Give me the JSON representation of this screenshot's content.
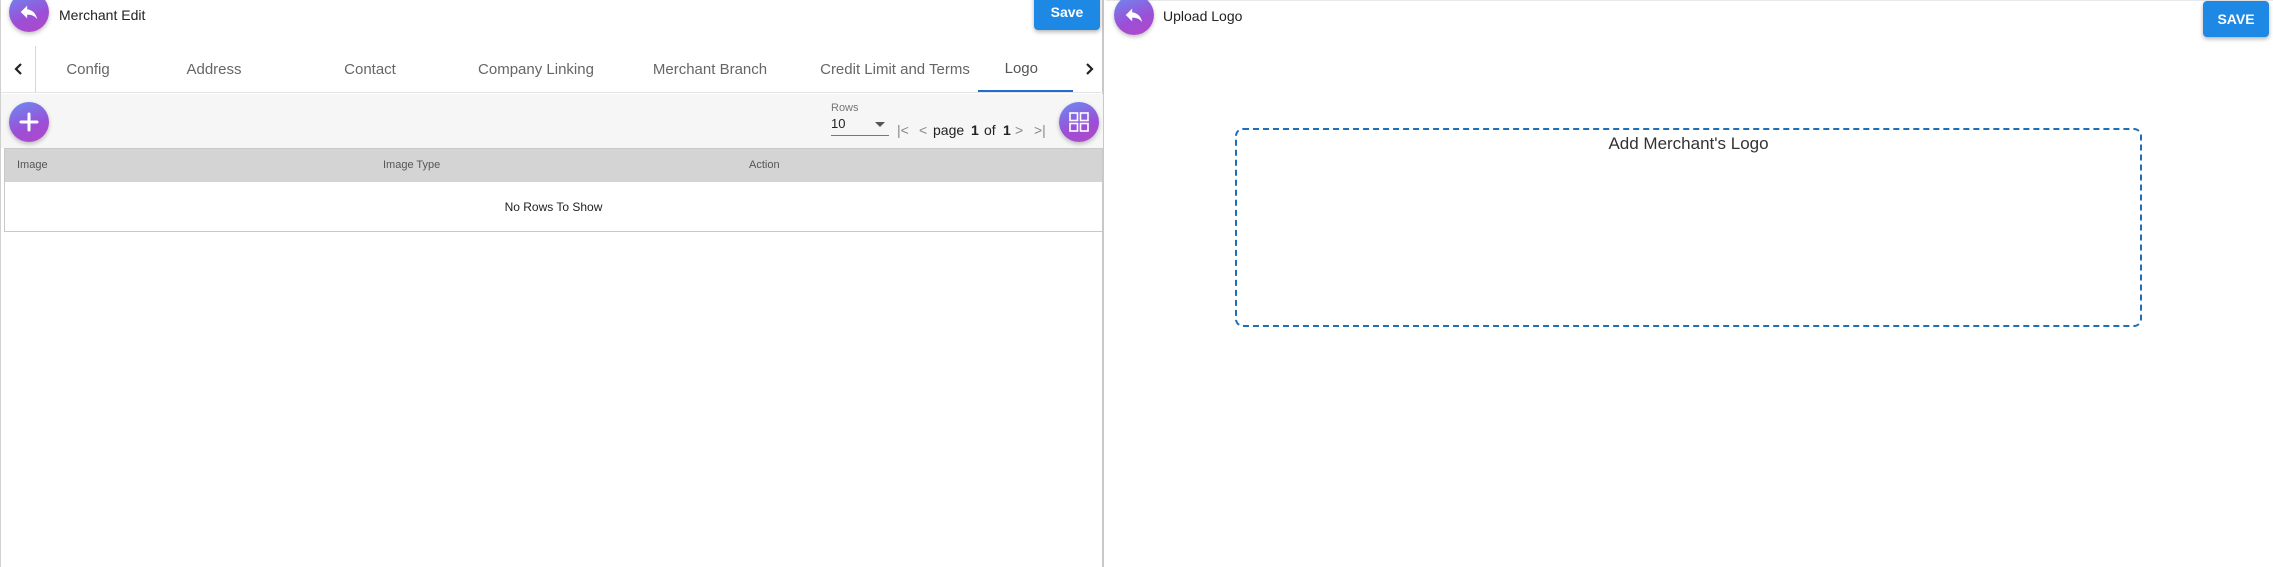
{
  "left_panel": {
    "title": "Merchant Edit",
    "save_label": "Save",
    "tabs": [
      {
        "label": "Config"
      },
      {
        "label": "Address"
      },
      {
        "label": "Contact"
      },
      {
        "label": "Company Linking"
      },
      {
        "label": "Merchant Branch"
      },
      {
        "label": "Credit Limit and Terms"
      },
      {
        "label": "Logo"
      }
    ],
    "active_tab": "Logo",
    "rows_label": "Rows",
    "rows_value": "10",
    "pager": {
      "first": "|<",
      "prev": "<",
      "page_word": "page",
      "current_page": "1",
      "of_word": "of",
      "total_pages": "1",
      "next": ">",
      "last": ">|"
    },
    "table": {
      "columns": [
        "Image",
        "Image Type",
        "Action"
      ],
      "empty_message": "No Rows To Show"
    }
  },
  "right_panel": {
    "title": "Upload Logo",
    "save_label": "SAVE",
    "dropzone_label": "Add Merchant's Logo"
  },
  "colors": {
    "primary": "#1e88e5",
    "gradient_start": "#6a8cf2",
    "gradient_end": "#b347c9",
    "dropzone_border": "#1e6fb8",
    "table_header": "#d4d4d4"
  },
  "icons": {
    "back": "back-arrow-icon",
    "add": "plus-icon",
    "grid_view": "grid-view-icon"
  }
}
